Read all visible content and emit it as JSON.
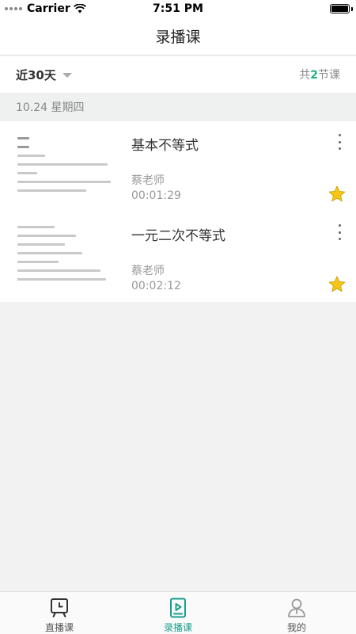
{
  "status_bar": {
    "carrier": "Carrier",
    "time": "7:51 PM",
    "battery_level": 1.0
  },
  "nav": {
    "title": "录播课"
  },
  "filter": {
    "range_label": "近30天",
    "count_prefix": "共",
    "count_value": "2",
    "count_suffix": "节课"
  },
  "date_header": {
    "label": "10.24 星期四"
  },
  "lessons": [
    {
      "title": "基本不等式",
      "teacher": "蔡老师",
      "duration": "00:01:29",
      "starred": true
    },
    {
      "title": "一元二次不等式",
      "teacher": "蔡老师",
      "duration": "00:02:12",
      "starred": true
    }
  ],
  "tabs": [
    {
      "label": "直播课",
      "icon": "live-class-icon",
      "active": false
    },
    {
      "label": "录播课",
      "icon": "recorded-class-icon",
      "active": true
    },
    {
      "label": "我的",
      "icon": "profile-icon",
      "active": false
    }
  ],
  "colors": {
    "accent": "#1a9e8c",
    "count_highlight": "#1ab07e",
    "star": "#f5c518",
    "date_header_bg": "#eef1f0"
  }
}
